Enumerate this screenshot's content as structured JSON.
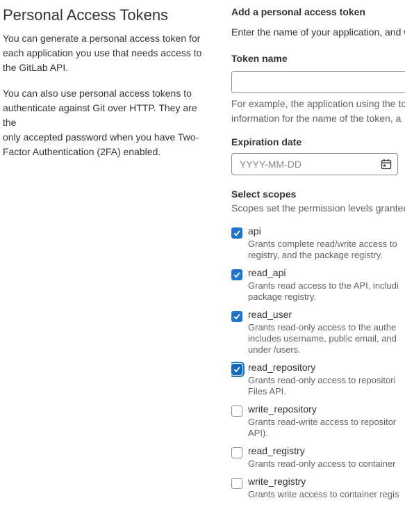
{
  "left": {
    "title": "Personal Access Tokens",
    "p1_lines": [
      "You can generate a personal access token for",
      "each application you use that needs access to",
      "the GitLab API."
    ],
    "p2_lines": [
      "You can also use personal access tokens to",
      "authenticate against Git over HTTP. They are the",
      "only accepted password when you have Two-",
      "Factor Authentication (2FA) enabled."
    ]
  },
  "form": {
    "section_title": "Add a personal access token",
    "section_help": "Enter the name of your application, and w",
    "token_name_label": "Token name",
    "token_name_value": "",
    "token_hint_lines": [
      "For example, the application using the to",
      "information for the name of the token, a"
    ],
    "expiration_label": "Expiration date",
    "expiration_placeholder": "YYYY-MM-DD",
    "expiration_icon": "calendar-icon",
    "scopes_label": "Select scopes",
    "scopes_help": "Scopes set the permission levels granted"
  },
  "scopes": [
    {
      "name": "api",
      "checked": true,
      "desc": "Grants complete read/write access to\nregistry, and the package registry."
    },
    {
      "name": "read_api",
      "checked": true,
      "desc": "Grants read access to the API, includi\npackage registry."
    },
    {
      "name": "read_user",
      "checked": true,
      "desc": "Grants read-only access to the authe\nincludes username, public email, and\nunder /users."
    },
    {
      "name": "read_repository",
      "checked": true,
      "focused": true,
      "desc": "Grants read-only access to repositori\nFiles API."
    },
    {
      "name": "write_repository",
      "checked": false,
      "desc": "Grants read-write access to repositor\nAPI)."
    },
    {
      "name": "read_registry",
      "checked": false,
      "desc": "Grants read-only access to container"
    },
    {
      "name": "write_registry",
      "checked": false,
      "desc": "Grants write access to container regis"
    }
  ],
  "colors": {
    "accent": "#1f75cb",
    "text": "#333238",
    "muted": "#626168",
    "border": "#89888d"
  }
}
